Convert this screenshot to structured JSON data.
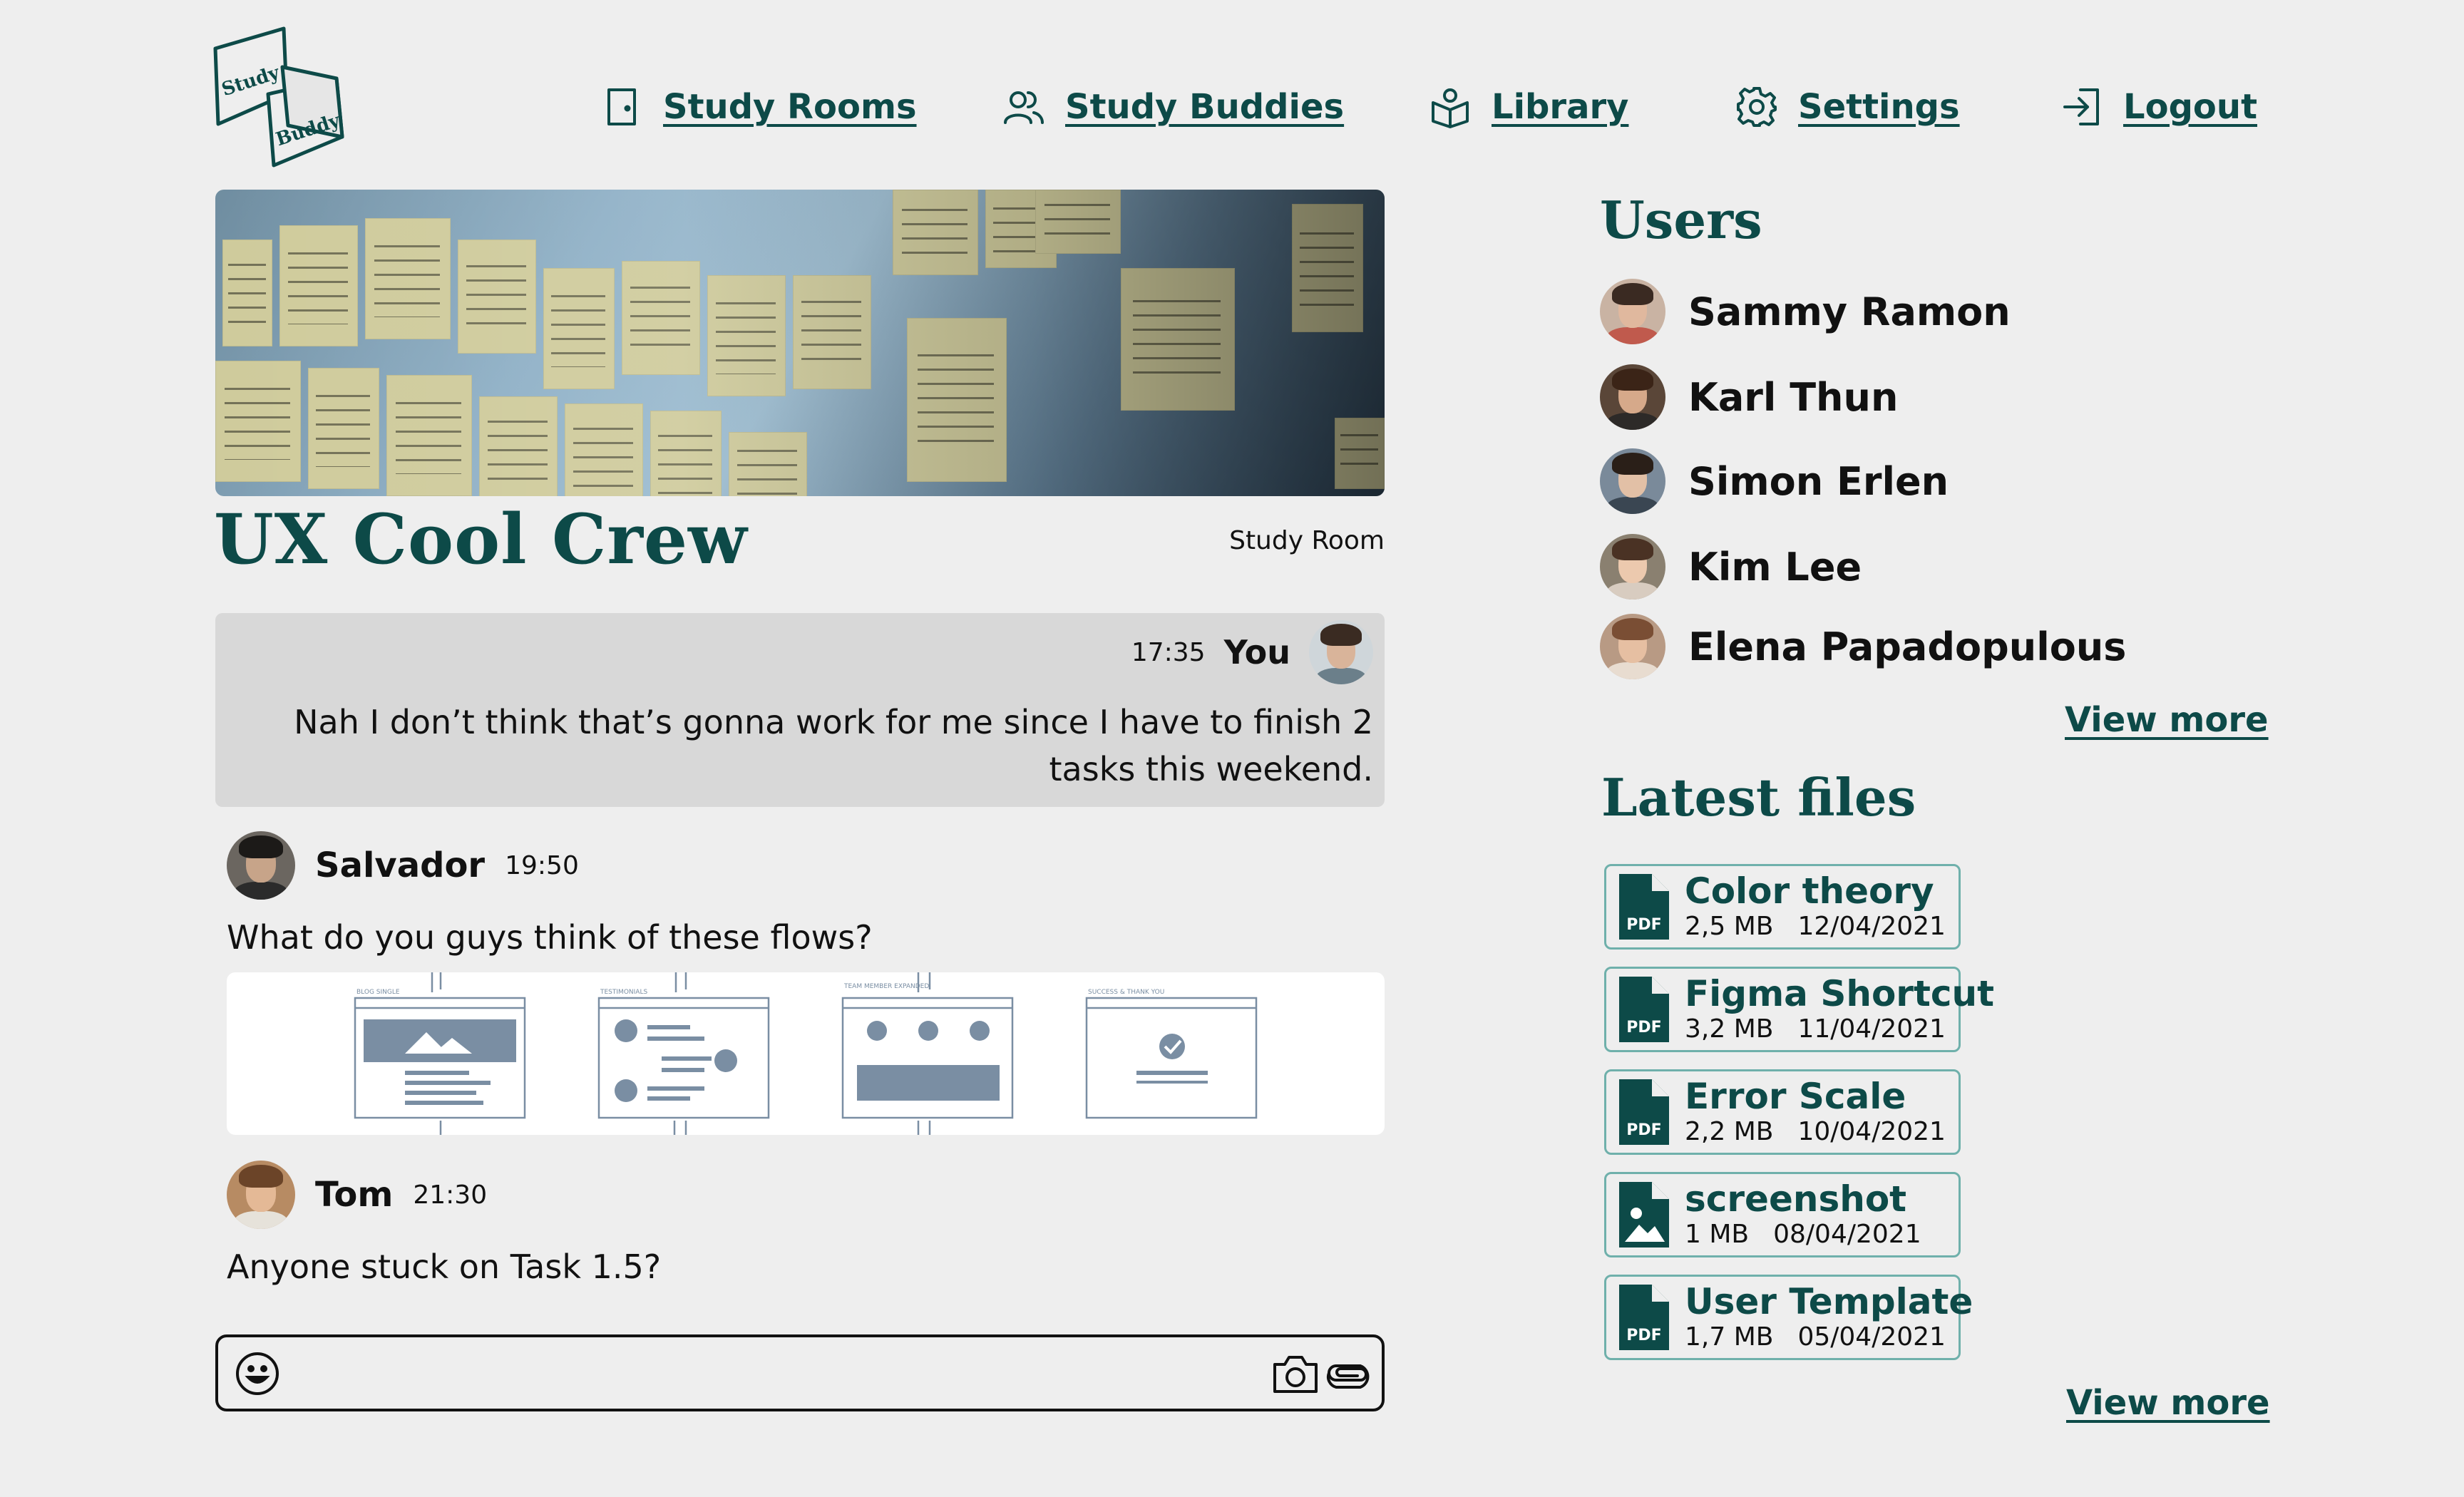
{
  "brand": {
    "logo_top": "Study",
    "logo_bottom": "Buddy"
  },
  "nav": [
    {
      "label": "Study Rooms",
      "icon": "door-icon"
    },
    {
      "label": "Study Buddies",
      "icon": "users-icon"
    },
    {
      "label": "Library",
      "icon": "book-icon"
    },
    {
      "label": "Settings",
      "icon": "gear-icon"
    },
    {
      "label": "Logout",
      "icon": "logout-icon"
    }
  ],
  "room": {
    "title": "UX Cool Crew",
    "type": "Study Room"
  },
  "messages": {
    "mine": {
      "time": "17:35",
      "author": "You",
      "text": "Nah I don’t think that’s gonna work for me since I have to finish 2 tasks this weekend."
    },
    "salvador": {
      "author": "Salvador",
      "time": "19:50",
      "text": "What do you guys think of these flows?"
    },
    "tom": {
      "author": "Tom",
      "time": "21:30",
      "text": "Anyone stuck on Task 1.5?"
    }
  },
  "flows": {
    "labels": [
      "BLOG SINGLE",
      "TESTIMONIALS",
      "TEAM MEMBER EXPANDED",
      "SUCCESS & THANK YOU"
    ]
  },
  "composer": {
    "placeholder": ""
  },
  "users": {
    "title": "Users",
    "list": [
      "Sammy Ramon",
      "Karl Thun",
      "Simon Erlen",
      "Kim Lee",
      "Elena Papadopulous"
    ],
    "view_more": "View more"
  },
  "files": {
    "title": "Latest files",
    "list": [
      {
        "name": "Color theory",
        "size": "2,5 MB",
        "date": "12/04/2021",
        "kind": "PDF"
      },
      {
        "name": "Figma Shortcut",
        "size": "3,2 MB",
        "date": "11/04/2021",
        "kind": "PDF"
      },
      {
        "name": "Error Scale",
        "size": "2,2 MB",
        "date": "10/04/2021",
        "kind": "PDF"
      },
      {
        "name": "screenshot",
        "size": "1 MB",
        "date": "08/04/2021",
        "kind": "image"
      },
      {
        "name": "User Template",
        "size": "1,7 MB",
        "date": "05/04/2021",
        "kind": "PDF"
      }
    ],
    "view_more": "View more"
  },
  "colors": {
    "accent": "#0d4a48",
    "card_border": "#6fb0ab",
    "background": "#eeeeee",
    "bubble": "#d8d8d8"
  }
}
